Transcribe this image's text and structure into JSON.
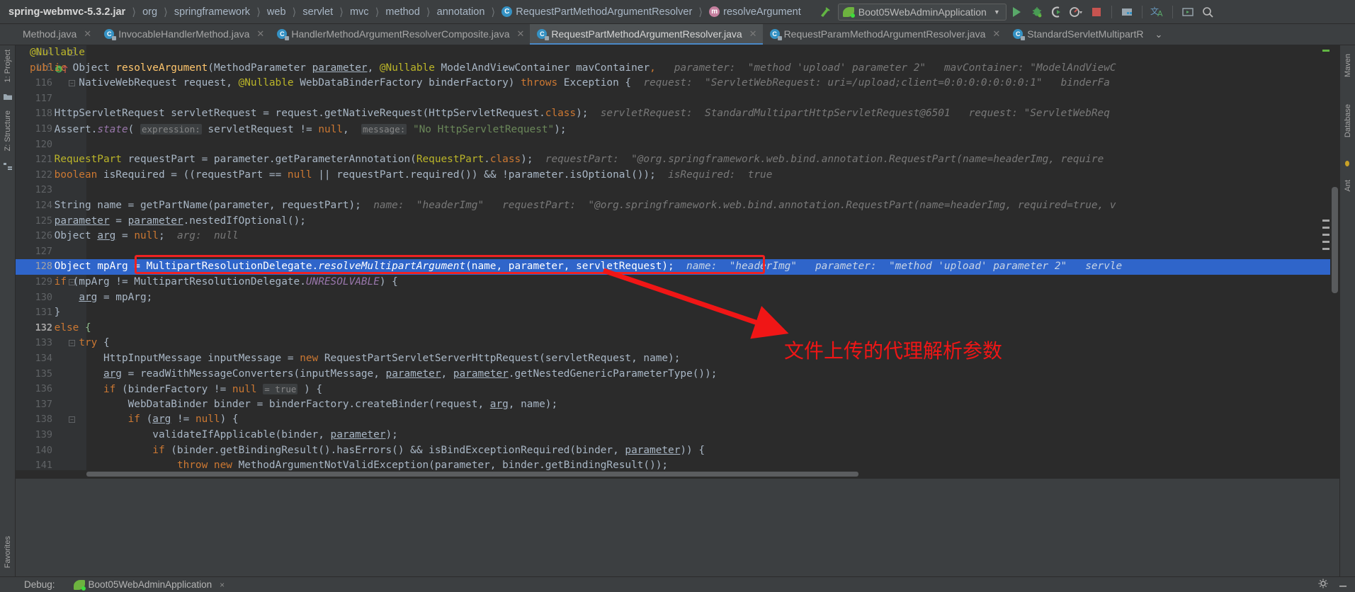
{
  "navbar": {
    "breadcrumbs": [
      {
        "label": "spring-webmvc-5.3.2.jar",
        "icon": "",
        "root": true
      },
      {
        "label": "org",
        "icon": ""
      },
      {
        "label": "springframework",
        "icon": ""
      },
      {
        "label": "web",
        "icon": ""
      },
      {
        "label": "servlet",
        "icon": ""
      },
      {
        "label": "mvc",
        "icon": ""
      },
      {
        "label": "method",
        "icon": ""
      },
      {
        "label": "annotation",
        "icon": ""
      },
      {
        "label": "RequestPartMethodArgumentResolver",
        "icon": "class-icon",
        "iconChar": "C"
      },
      {
        "label": "resolveArgument",
        "icon": "method-icon",
        "iconChar": "m"
      }
    ],
    "run_config": "Boot05WebAdminApplication",
    "tools": [
      {
        "name": "build-hammer-icon"
      },
      {
        "name": "run-button"
      },
      {
        "name": "debug-button"
      },
      {
        "name": "run-with-coverage-button"
      },
      {
        "name": "profiler-button"
      },
      {
        "name": "stop-button"
      },
      {
        "name": "database-icon"
      },
      {
        "name": "translate-icon"
      },
      {
        "name": "layout-icon"
      },
      {
        "name": "search-everywhere-icon"
      }
    ]
  },
  "tabs": [
    {
      "label": "Method.java",
      "active": false,
      "partial": true
    },
    {
      "label": "InvocableHandlerMethod.java",
      "active": false
    },
    {
      "label": "HandlerMethodArgumentResolverComposite.java",
      "active": false
    },
    {
      "label": "RequestPartMethodArgumentResolver.java",
      "active": true
    },
    {
      "label": "RequestParamMethodArgumentResolver.java",
      "active": false
    },
    {
      "label": "StandardServletMultipartR",
      "active": false,
      "truncated": true
    }
  ],
  "tab_overflow": "⌄",
  "left_strip": {
    "items": [
      {
        "label": "1: Project",
        "name": "tool-window-project"
      },
      {
        "label": "Z: Structure",
        "name": "tool-window-structure"
      },
      {
        "label": "Favorites",
        "name": "tool-window-favorites"
      }
    ]
  },
  "right_strip": {
    "items": [
      {
        "label": "Maven",
        "name": "tool-window-maven"
      },
      {
        "label": "Database",
        "name": "tool-window-database"
      },
      {
        "label": "Ant",
        "name": "tool-window-ant"
      }
    ]
  },
  "editor": {
    "first_line": 114,
    "current_line": 128,
    "highlighted_line_number": 132,
    "lines": [
      {
        "n": 114,
        "indent": 4,
        "text": "@Nullable",
        "cls": "ann",
        "fold": true
      },
      {
        "n": 115,
        "indent": 4,
        "breakpoint": true
      },
      {
        "n": 116,
        "indent": 8,
        "fold": true
      },
      {
        "n": 117,
        "indent": 0
      },
      {
        "n": 118,
        "indent": 8
      },
      {
        "n": 119,
        "indent": 8
      },
      {
        "n": 120,
        "indent": 0
      },
      {
        "n": 121,
        "indent": 8
      },
      {
        "n": 122,
        "indent": 8
      },
      {
        "n": 123,
        "indent": 0
      },
      {
        "n": 124,
        "indent": 8
      },
      {
        "n": 125,
        "indent": 8
      },
      {
        "n": 126,
        "indent": 8
      },
      {
        "n": 127,
        "indent": 0
      },
      {
        "n": 128,
        "indent": 8,
        "current": true
      },
      {
        "n": 129,
        "indent": 8,
        "fold": true
      },
      {
        "n": 130,
        "indent": 12
      },
      {
        "n": 131,
        "indent": 8
      },
      {
        "n": 132,
        "indent": 8,
        "bold_number": true
      },
      {
        "n": 133,
        "indent": 12,
        "fold": true
      },
      {
        "n": 134,
        "indent": 16
      },
      {
        "n": 135,
        "indent": 16
      },
      {
        "n": 136,
        "indent": 16
      },
      {
        "n": 137,
        "indent": 20
      },
      {
        "n": 138,
        "indent": 20,
        "fold": true
      },
      {
        "n": 139,
        "indent": 24
      },
      {
        "n": 140,
        "indent": 24
      },
      {
        "n": 141,
        "indent": 28
      }
    ],
    "inlay_hints": {
      "l115_parameter": "parameter:  \"method 'upload' parameter 2\"",
      "l115_mav": "mavContainer:  \"ModelAndViewC",
      "l116_request": "request:  \"ServletWebRequest: uri=/upload;client=0:0:0:0:0:0:0:1\"",
      "l116_binder": "binderFa",
      "l118_servletRequest": "servletRequest:  StandardMultipartHttpServletRequest@6501",
      "l118_request2": "request:  \"ServletWebRequ",
      "l121_requestPart": "requestPart:  \"@org.springframework.web.bind.annotation.RequestPart(name=headerImg, require",
      "l122_isRequired": "isRequired:  true",
      "l124_name": "name:  \"headerImg\"",
      "l124_requestPart": "requestPart:  \"@org.springframework.web.bind.annotation.RequestPart(name=headerImg, required=true, v",
      "l126_arg": "arg:  null",
      "l128_name": "name:  \"headerImg\"",
      "l128_parameter": "parameter:  \"method 'upload' parameter 2\"",
      "l128_servlet": "servle"
    }
  },
  "annotation": {
    "note_text": "文件上传的代理解析参数",
    "note_color": "#f01616",
    "box_color": "#ee2222"
  },
  "bottom": {
    "debug_label": "Debug:",
    "debug_session": "Boot05WebAdminApplication",
    "close_glyph": "×"
  }
}
